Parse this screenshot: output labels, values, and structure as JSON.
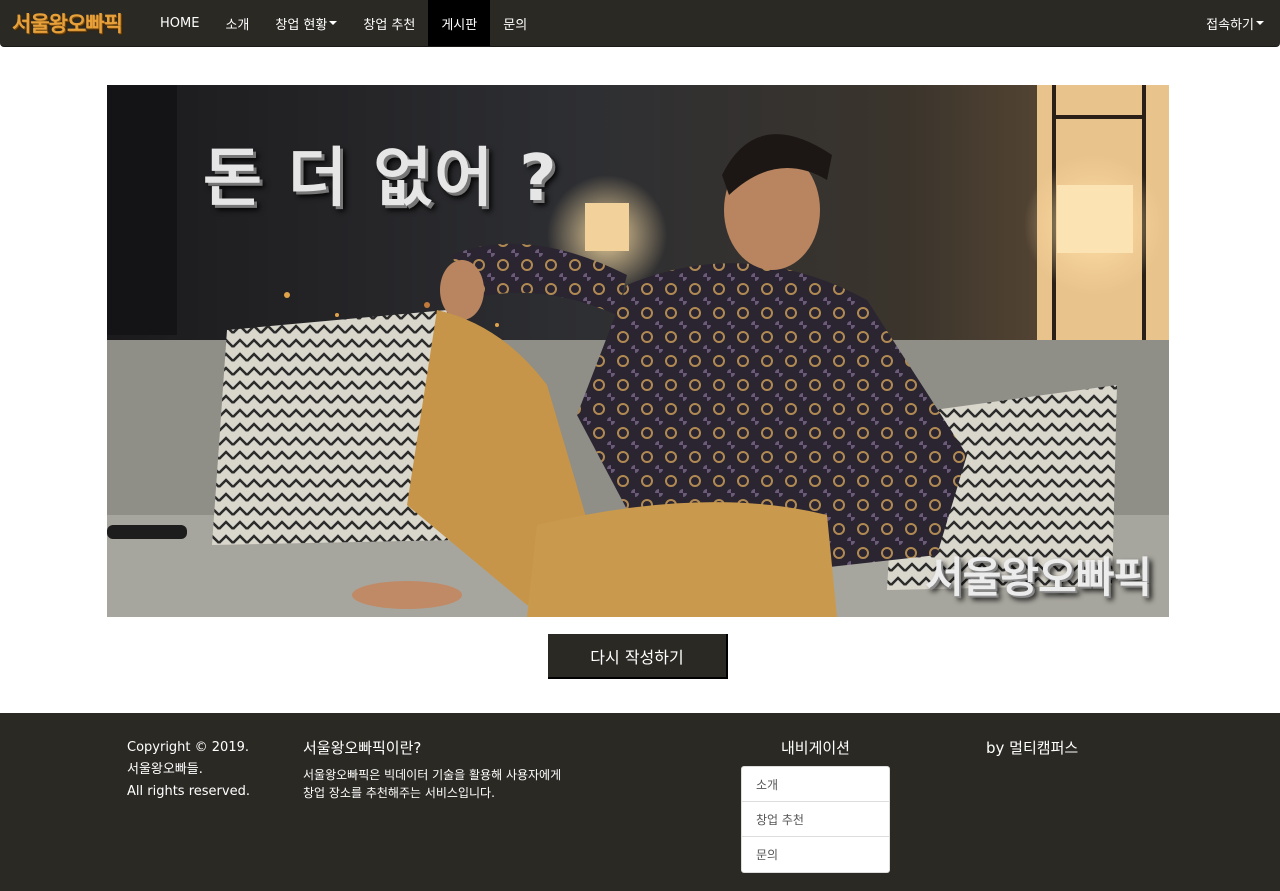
{
  "navbar": {
    "brand": "서울왕오빠픽",
    "items": [
      {
        "label": "HOME",
        "dropdown": false,
        "active": false
      },
      {
        "label": "소개",
        "dropdown": false,
        "active": false
      },
      {
        "label": "창업 현황",
        "dropdown": true,
        "active": false
      },
      {
        "label": "창업 추천",
        "dropdown": false,
        "active": false
      },
      {
        "label": "게시판",
        "dropdown": false,
        "active": true
      },
      {
        "label": "문의",
        "dropdown": false,
        "active": false
      }
    ],
    "right_label": "접속하기"
  },
  "banner": {
    "headline": "돈 더 없어 ?",
    "logo_text": "서울왕오빠픽"
  },
  "main": {
    "rewrite_button": "다시 작성하기"
  },
  "footer": {
    "copyright_lines": [
      "Copyright © 2019.",
      "서울왕오빠들.",
      "All rights reserved."
    ],
    "about_title": "서울왕오빠픽이란?",
    "about_lines": [
      "서울왕오빠픽은 빅데이터 기술을 활용해 사용자에게",
      "창업 장소를 추천해주는 서비스입니다."
    ],
    "nav_title": "내비게이션",
    "nav_items": [
      "소개",
      "창업 추천",
      "문의"
    ],
    "byline": "by 멀티캠퍼스"
  },
  "colors": {
    "navbar_bg": "#2b2924",
    "brand": "#e8a13a",
    "active_nav": "#000000",
    "footer_bg": "#2b2924"
  }
}
